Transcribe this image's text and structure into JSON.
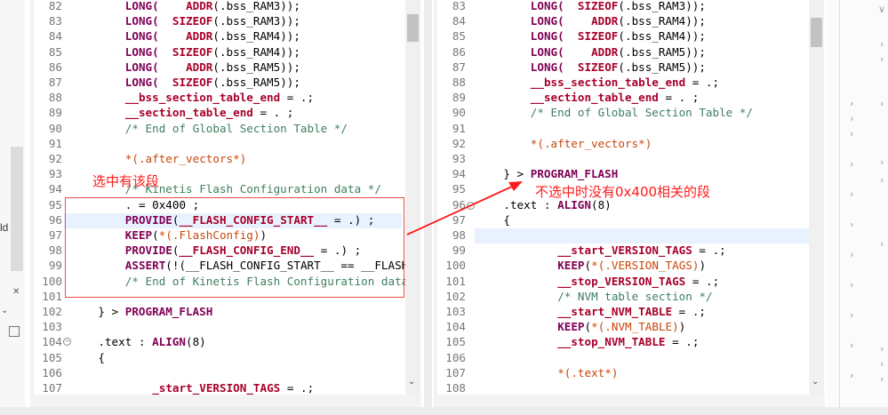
{
  "left_editor": {
    "lines": [
      {
        "n": "82",
        "segs": [
          [
            "kw",
            "LONG("
          ],
          [
            "plain",
            "    "
          ],
          [
            "red",
            "ADDR"
          ],
          [
            "plain",
            "(.bss_RAM3));"
          ]
        ]
      },
      {
        "n": "83",
        "segs": [
          [
            "kw",
            "LONG("
          ],
          [
            "plain",
            "  "
          ],
          [
            "red",
            "SIZEOF"
          ],
          [
            "plain",
            "(.bss_RAM3));"
          ]
        ]
      },
      {
        "n": "84",
        "segs": [
          [
            "kw",
            "LONG("
          ],
          [
            "plain",
            "    "
          ],
          [
            "red",
            "ADDR"
          ],
          [
            "plain",
            "(.bss_RAM4));"
          ]
        ]
      },
      {
        "n": "85",
        "segs": [
          [
            "kw",
            "LONG("
          ],
          [
            "plain",
            "  "
          ],
          [
            "red",
            "SIZEOF"
          ],
          [
            "plain",
            "(.bss_RAM4));"
          ]
        ]
      },
      {
        "n": "86",
        "segs": [
          [
            "kw",
            "LONG("
          ],
          [
            "plain",
            "    "
          ],
          [
            "red",
            "ADDR"
          ],
          [
            "plain",
            "(.bss_RAM5));"
          ]
        ]
      },
      {
        "n": "87",
        "segs": [
          [
            "kw",
            "LONG("
          ],
          [
            "plain",
            "  "
          ],
          [
            "red",
            "SIZEOF"
          ],
          [
            "plain",
            "(.bss_RAM5));"
          ]
        ]
      },
      {
        "n": "88",
        "segs": [
          [
            "red",
            "__bss_section_table_end"
          ],
          [
            "plain",
            " = .;"
          ]
        ]
      },
      {
        "n": "89",
        "segs": [
          [
            "red",
            "__section_table_end"
          ],
          [
            "plain",
            " = . ;"
          ]
        ]
      },
      {
        "n": "90",
        "segs": [
          [
            "cmt",
            "/* End of Global Section Table */"
          ]
        ]
      },
      {
        "n": "91",
        "segs": []
      },
      {
        "n": "92",
        "segs": [
          [
            "sect",
            "*(.after_vectors*)"
          ]
        ]
      },
      {
        "n": "93",
        "segs": []
      },
      {
        "n": "94",
        "segs": [
          [
            "cmt",
            "/* Kinetis Flash Configuration data */"
          ]
        ]
      },
      {
        "n": "95",
        "segs": [
          [
            "plain",
            ". = 0x400 ;"
          ]
        ]
      },
      {
        "n": "96",
        "segs": [
          [
            "kw",
            "PROVIDE"
          ],
          [
            "plain",
            "("
          ],
          [
            "red",
            "__FLASH_CONFIG_START__"
          ],
          [
            "plain",
            " = .) ;"
          ]
        ]
      },
      {
        "n": "97",
        "segs": [
          [
            "kw",
            "KEEP"
          ],
          [
            "plain",
            "("
          ],
          [
            "sect",
            "*(.FlashConfig)"
          ],
          [
            "plain",
            ")"
          ]
        ]
      },
      {
        "n": "98",
        "segs": [
          [
            "kw",
            "PROVIDE"
          ],
          [
            "plain",
            "("
          ],
          [
            "red",
            "__FLASH_CONFIG_END__"
          ],
          [
            "plain",
            " = .) ;"
          ]
        ]
      },
      {
        "n": "99",
        "segs": [
          [
            "kw",
            "ASSERT"
          ],
          [
            "plain",
            "(!(__FLASH_CONFIG_START__ == __FLASH"
          ]
        ]
      },
      {
        "n": "100",
        "segs": [
          [
            "cmt",
            "/* End of Kinetis Flash Configuration data"
          ]
        ]
      },
      {
        "n": "101",
        "segs": []
      },
      {
        "n": "102",
        "segs": [
          [
            "plain",
            "} > "
          ],
          [
            "kw",
            "PROGRAM_FLASH"
          ]
        ]
      },
      {
        "n": "103",
        "segs": []
      },
      {
        "n": "104",
        "segs": [
          [
            "plain",
            ".text : "
          ],
          [
            "kw",
            "ALIGN"
          ],
          [
            "plain",
            "(8)"
          ]
        ]
      },
      {
        "n": "105",
        "segs": [
          [
            "plain",
            "{"
          ]
        ]
      },
      {
        "n": "106",
        "segs": []
      },
      {
        "n": "107",
        "segs": [
          [
            "red",
            "_start_VERSION_TAGS"
          ],
          [
            "plain",
            " = .;"
          ]
        ]
      }
    ]
  },
  "right_editor": {
    "lines": [
      {
        "n": "83",
        "segs": [
          [
            "kw",
            "LONG("
          ],
          [
            "plain",
            "  "
          ],
          [
            "red",
            "SIZEOF"
          ],
          [
            "plain",
            "(.bss_RAM3));"
          ]
        ]
      },
      {
        "n": "84",
        "segs": [
          [
            "kw",
            "LONG("
          ],
          [
            "plain",
            "    "
          ],
          [
            "red",
            "ADDR"
          ],
          [
            "plain",
            "(.bss_RAM4));"
          ]
        ]
      },
      {
        "n": "85",
        "segs": [
          [
            "kw",
            "LONG("
          ],
          [
            "plain",
            "  "
          ],
          [
            "red",
            "SIZEOF"
          ],
          [
            "plain",
            "(.bss_RAM4));"
          ]
        ]
      },
      {
        "n": "86",
        "segs": [
          [
            "kw",
            "LONG("
          ],
          [
            "plain",
            "    "
          ],
          [
            "red",
            "ADDR"
          ],
          [
            "plain",
            "(.bss_RAM5));"
          ]
        ]
      },
      {
        "n": "87",
        "segs": [
          [
            "kw",
            "LONG("
          ],
          [
            "plain",
            "  "
          ],
          [
            "red",
            "SIZEOF"
          ],
          [
            "plain",
            "(.bss_RAM5));"
          ]
        ]
      },
      {
        "n": "88",
        "segs": [
          [
            "red",
            "__bss_section_table_end"
          ],
          [
            "plain",
            " = .;"
          ]
        ]
      },
      {
        "n": "89",
        "segs": [
          [
            "red",
            "__section_table_end"
          ],
          [
            "plain",
            " = . ;"
          ]
        ]
      },
      {
        "n": "90",
        "segs": [
          [
            "cmt",
            "/* End of Global Section Table */"
          ]
        ]
      },
      {
        "n": "91",
        "segs": []
      },
      {
        "n": "92",
        "segs": [
          [
            "sect",
            "*(.after_vectors*)"
          ]
        ]
      },
      {
        "n": "93",
        "segs": []
      },
      {
        "n": "94",
        "segs": [
          [
            "plain",
            "} > "
          ],
          [
            "kw",
            "PROGRAM_FLASH"
          ]
        ]
      },
      {
        "n": "95",
        "segs": []
      },
      {
        "n": "96",
        "segs": [
          [
            "plain",
            ".text : "
          ],
          [
            "kw",
            "ALIGN"
          ],
          [
            "plain",
            "(8)"
          ]
        ]
      },
      {
        "n": "97",
        "segs": [
          [
            "plain",
            "{"
          ]
        ]
      },
      {
        "n": "98",
        "segs": []
      },
      {
        "n": "99",
        "segs": [
          [
            "red",
            "__start_VERSION_TAGS"
          ],
          [
            "plain",
            " = .;"
          ]
        ]
      },
      {
        "n": "100",
        "segs": [
          [
            "kw",
            "KEEP"
          ],
          [
            "plain",
            "("
          ],
          [
            "sect",
            "*(.VERSION_TAGS)"
          ],
          [
            "plain",
            ")"
          ]
        ]
      },
      {
        "n": "101",
        "segs": [
          [
            "red",
            "__stop_VERSION_TAGS"
          ],
          [
            "plain",
            " = .;"
          ]
        ]
      },
      {
        "n": "102",
        "segs": [
          [
            "cmt",
            "/* NVM table section */"
          ]
        ]
      },
      {
        "n": "103",
        "segs": [
          [
            "red",
            "__start_NVM_TABLE"
          ],
          [
            "plain",
            " = .;"
          ]
        ]
      },
      {
        "n": "104",
        "segs": [
          [
            "kw",
            "KEEP"
          ],
          [
            "plain",
            "("
          ],
          [
            "sect",
            "*(.NVM_TABLE)"
          ],
          [
            "plain",
            ")"
          ]
        ]
      },
      {
        "n": "105",
        "segs": [
          [
            "red",
            "__stop_NVM_TABLE"
          ],
          [
            "plain",
            " = .;"
          ]
        ]
      },
      {
        "n": "106",
        "segs": []
      },
      {
        "n": "107",
        "segs": [
          [
            "sect",
            "*(.text*)"
          ]
        ]
      },
      {
        "n": "108",
        "segs": []
      }
    ]
  },
  "annotations": {
    "left_note": "选中有该段",
    "right_note": "不选中时没有0x400相关的段"
  },
  "side_label": "ld",
  "colors": {
    "annotation": "#ff1a1a",
    "line_highlight": "#e8f2fe"
  }
}
